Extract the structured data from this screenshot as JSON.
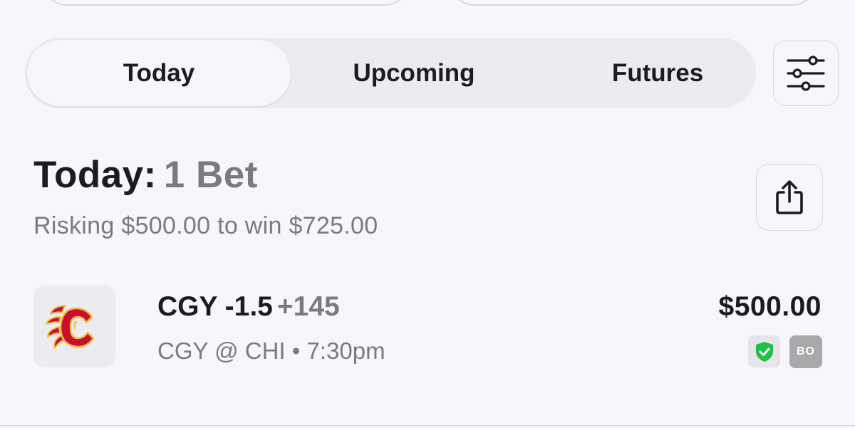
{
  "tabs": [
    {
      "label": "Today",
      "active": true
    },
    {
      "label": "Upcoming",
      "active": false
    },
    {
      "label": "Futures",
      "active": false
    }
  ],
  "toolbar": {
    "filter_icon": "sliders-icon",
    "share_icon": "share-icon"
  },
  "summary": {
    "heading": "Today:",
    "count": "1 Bet",
    "subtitle": "Risking $500.00 to win $725.00"
  },
  "bet": {
    "team_logo": "calgary-flames-logo",
    "selection": "CGY -1.5",
    "odds": "+145",
    "matchup": "CGY @ CHI",
    "separator": "•",
    "time": "7:30pm",
    "stake": "$500.00",
    "verified_icon": "shield-check-icon",
    "sportsbook_abbr": "BO"
  },
  "colors": {
    "background": "#f7f7fb",
    "segment_track": "#ebebf0",
    "primary_text": "#1c1c1f",
    "secondary_text": "#7a7a80",
    "shield_green": "#1fbf4a",
    "flames_red": "#c8102e",
    "flames_gold": "#f1be48"
  }
}
